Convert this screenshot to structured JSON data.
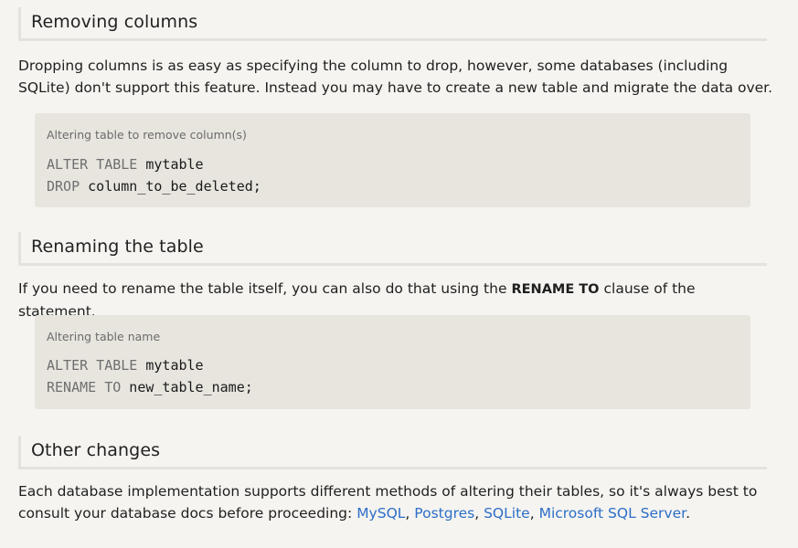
{
  "sections": [
    {
      "heading": "Removing columns",
      "paragraph": "Dropping columns is as easy as specifying the column to drop, however, some databases (including SQLite) don't support this feature. Instead you may have to create a new table and migrate the data over.",
      "code_caption": "Altering table to remove column(s)",
      "code": {
        "line1_kw": "ALTER TABLE",
        "line1_val": " mytable",
        "line2_kw": "DROP",
        "line2_val": " column_to_be_deleted;"
      }
    },
    {
      "heading": "Renaming the table",
      "paragraph_before": "If you need to rename the table itself, you can also do that using the",
      "paragraph_strong": "RENAME TO",
      "paragraph_after": "clause of the statement.",
      "code_caption": "Altering table name",
      "code": {
        "line1_kw": "ALTER TABLE",
        "line1_val": " mytable",
        "line2_kw": "RENAME TO",
        "line2_val": " new_table_name;"
      }
    },
    {
      "heading": "Other changes",
      "paragraph_before": "Each database implementation supports different methods of altering their tables, so it's always best to consult your database docs before proceeding:",
      "links": [
        "MySQL",
        "Postgres",
        "SQLite",
        "Microsoft SQL Server"
      ],
      "separator": ",",
      "end": "."
    }
  ]
}
